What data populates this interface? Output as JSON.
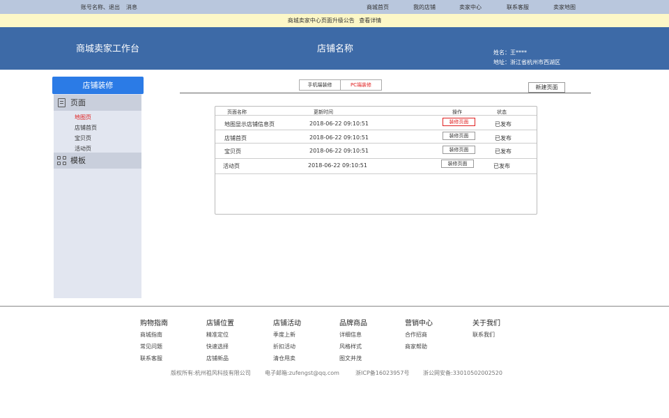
{
  "topbar": {
    "account": "账号名称、退出",
    "messages": "消息",
    "links": [
      "商城首页",
      "我的店铺",
      "卖家中心",
      "联系客服",
      "卖家地图"
    ]
  },
  "notice": {
    "text": "商城卖家中心页面升级公告",
    "link": "查看详情"
  },
  "header": {
    "workbench": "商城卖家工作台",
    "shop_name": "店铺名称",
    "name_label": "姓名：王****",
    "address_label": "地址：浙江省杭州市西湖区"
  },
  "sidebar": {
    "title": "店铺装修",
    "page_section": "页面",
    "page_items": [
      "地图页",
      "店铺首页",
      "宝贝页",
      "活动页"
    ],
    "template_section": "模板"
  },
  "tabs": {
    "mobile": "手机端装修",
    "pc": "PC端装修",
    "active": "pc"
  },
  "new_page_button": "新建页面",
  "table": {
    "headers": {
      "name": "页面名称",
      "updated": "更新时间",
      "action": "操作",
      "status": "状态"
    },
    "rows": [
      {
        "name": "地图显示店铺信息页",
        "time": "2018-06-22  09:10:51",
        "action": "装修页面",
        "status": "已发布"
      },
      {
        "name": "店铺首页",
        "time": "2018-06-22  09:10:51",
        "action": "装修页面",
        "status": "已发布"
      },
      {
        "name": "宝贝页",
        "time": "2018-06-22  09:10:51",
        "action": "装修页面",
        "status": "已发布"
      },
      {
        "name": "活动页",
        "time": "2018-06-22  09:10:51",
        "action": "装修页面",
        "status": "已发布"
      }
    ]
  },
  "footer": {
    "columns": [
      {
        "title": "购物指南",
        "items": [
          "商城指南",
          "常见问题",
          "联系客服"
        ]
      },
      {
        "title": "店铺位置",
        "items": [
          "精准定位",
          "快速选择",
          "店铺新品"
        ]
      },
      {
        "title": "店铺活动",
        "items": [
          "季度上新",
          "折扣活动",
          "清仓甩卖"
        ]
      },
      {
        "title": "品牌商品",
        "items": [
          "详细信息",
          "风格样式",
          "图文并茂"
        ]
      },
      {
        "title": "营销中心",
        "items": [
          "合作招商",
          "商家帮助"
        ]
      },
      {
        "title": "关于我们",
        "items": [
          "联系我们"
        ]
      }
    ],
    "copyright": "版权所有:杭州祖风科技有限公司",
    "email": "电子邮箱:zufengst@qq.com",
    "icp": "浙ICP备16023957号",
    "police": "浙公网安备:33010502002520"
  },
  "colors": {
    "accent": "#2b7be6",
    "header_bg": "#3d6aa7",
    "active_red": "#e02020",
    "notice_bg": "#fcf7c7"
  }
}
